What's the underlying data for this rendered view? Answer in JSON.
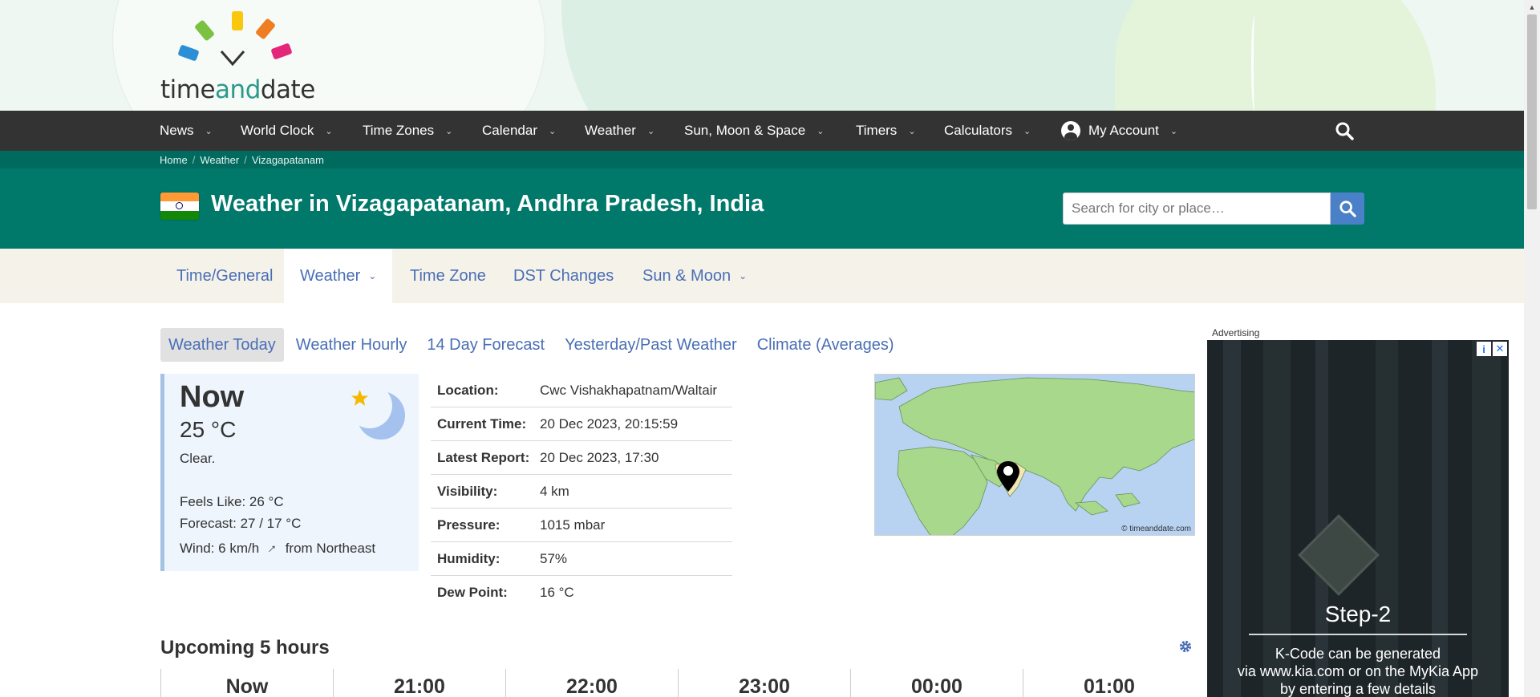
{
  "brand": {
    "logo_part1": "time",
    "logo_part2": "and",
    "logo_part3": "date"
  },
  "nav": {
    "items": [
      "News",
      "World Clock",
      "Time Zones",
      "Calendar",
      "Weather",
      "Sun, Moon & Space",
      "Timers",
      "Calculators"
    ],
    "account": "My Account"
  },
  "breadcrumb": [
    "Home",
    "Weather",
    "Vizagapatanam"
  ],
  "title": "Weather in Vizagapatanam, Andhra Pradesh, India",
  "search": {
    "placeholder": "Search for city or place…"
  },
  "subnav": {
    "tabs": [
      "Time/General",
      "Weather",
      "Time Zone",
      "DST Changes",
      "Sun & Moon"
    ]
  },
  "weather_links": [
    "Weather Today",
    "Weather Hourly",
    "14 Day Forecast",
    "Yesterday/Past Weather",
    "Climate (Averages)"
  ],
  "now": {
    "title": "Now",
    "temp": "25 °C",
    "desc": "Clear.",
    "feels_like": "Feels Like: 26 °C",
    "forecast": "Forecast: 27 / 17 °C",
    "wind_prefix": "Wind: 6 km/h",
    "wind_arrow": "↑",
    "wind_suffix": "from Northeast"
  },
  "details": [
    {
      "k": "Location:",
      "v": "Cwc Vishakhapatnam/Waltair"
    },
    {
      "k": "Current Time:",
      "v": "20 Dec 2023, 20:15:59"
    },
    {
      "k": "Latest Report:",
      "v": "20 Dec 2023, 17:30"
    },
    {
      "k": "Visibility:",
      "v": "4 km"
    },
    {
      "k": "Pressure:",
      "v": "1015 mbar"
    },
    {
      "k": "Humidity:",
      "v": "57%"
    },
    {
      "k": "Dew Point:",
      "v": "16 °C"
    }
  ],
  "map": {
    "credit": "© timeanddate.com"
  },
  "upcoming": {
    "title": "Upcoming 5 hours",
    "hours": [
      "Now",
      "21:00",
      "22:00",
      "23:00",
      "00:00",
      "01:00"
    ]
  },
  "ad": {
    "label": "Advertising",
    "heading": "Step-2",
    "line1": "K-Code can be generated",
    "line2": "via www.kia.com or on the MyKia App",
    "line3": "by entering a few details"
  },
  "colors": {
    "nav_bg": "#333333",
    "teal": "#00796b",
    "link": "#4a6fb5",
    "now_bg": "#eef5fc"
  }
}
